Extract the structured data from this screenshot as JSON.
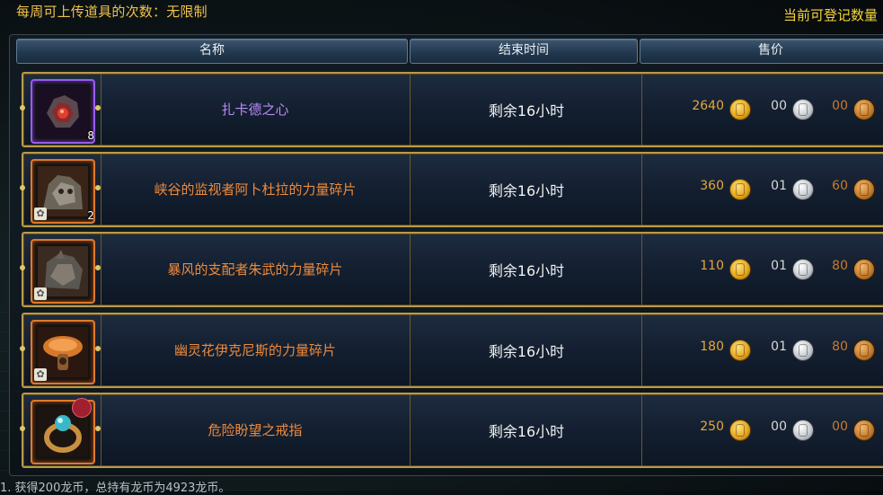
{
  "header_info": {
    "weekly_upload": "每周可上传道具的次数：无限制",
    "register_count": "当前可登记数量"
  },
  "columns": {
    "name": "名称",
    "end_time": "结束时间",
    "price": "售价"
  },
  "items": [
    {
      "name": "扎卡德之心",
      "rarity": "purple",
      "count": "8",
      "sealed": false,
      "time": "剩余16小时",
      "gold": "2640",
      "silver": "00",
      "copper": "00",
      "icon": "heart-crystal-icon"
    },
    {
      "name": "峡谷的监视者阿卜杜拉的力量碎片",
      "rarity": "orange",
      "count": "2",
      "sealed": true,
      "time": "剩余16小时",
      "gold": "360",
      "silver": "01",
      "copper": "60",
      "icon": "monster-fragment-icon"
    },
    {
      "name": "暴风的支配者朱武的力量碎片",
      "rarity": "orange",
      "count": "",
      "sealed": true,
      "time": "剩余16小时",
      "gold": "110",
      "silver": "01",
      "copper": "80",
      "icon": "monster-fragment-icon"
    },
    {
      "name": "幽灵花伊克尼斯的力量碎片",
      "rarity": "orange",
      "count": "",
      "sealed": true,
      "time": "剩余16小时",
      "gold": "180",
      "silver": "01",
      "copper": "80",
      "icon": "mushroom-fragment-icon"
    },
    {
      "name": "危险盼望之戒指",
      "rarity": "orange",
      "count": "",
      "sealed": false,
      "time": "剩余16小时",
      "gold": "250",
      "silver": "00",
      "copper": "00",
      "icon": "ring-icon"
    }
  ],
  "footer": {
    "chat_line": "1. 获得200龙币，总持有龙币为4923龙币。"
  },
  "colors": {
    "gold_text": "#f0c24a",
    "purple": "#b98cf5",
    "orange": "#ee8a3c",
    "frame": "#b89a4a"
  }
}
